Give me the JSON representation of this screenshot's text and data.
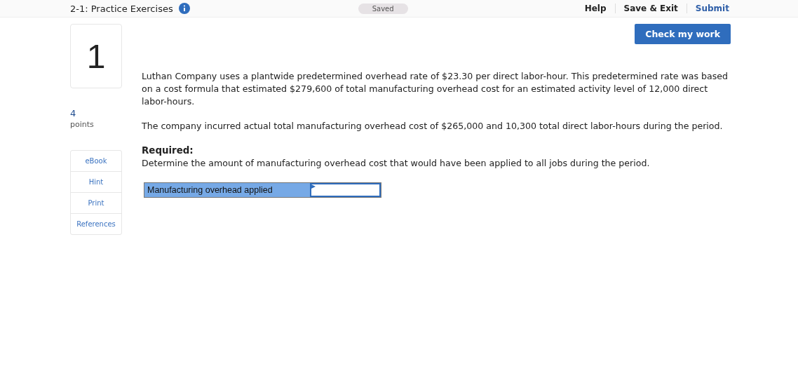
{
  "header": {
    "title": "2-1: Practice Exercises",
    "status": "Saved",
    "links": [
      {
        "label": "Help",
        "kind": "plain"
      },
      {
        "label": "Save & Exit",
        "kind": "plain"
      },
      {
        "label": "Submit",
        "kind": "primary"
      }
    ]
  },
  "question": {
    "number": "1",
    "points": "4",
    "points_label": "points"
  },
  "tools": [
    "eBook",
    "Hint",
    "Print",
    "References"
  ],
  "check_button": "Check my work",
  "paragraphs": [
    "Luthan Company uses a plantwide predetermined overhead rate of $23.30 per direct labor-hour. This predetermined rate was based on a cost formula that estimated $279,600 of total manufacturing overhead cost for an estimated activity level of 12,000 direct labor-hours.",
    "The company incurred actual total manufacturing overhead cost of $265,000 and 10,300 total direct labor-hours during the period."
  ],
  "required": {
    "heading": "Required:",
    "text": "Determine the amount of manufacturing overhead cost that would have been applied to all jobs during the period."
  },
  "answer": {
    "label": "Manufacturing overhead applied"
  }
}
